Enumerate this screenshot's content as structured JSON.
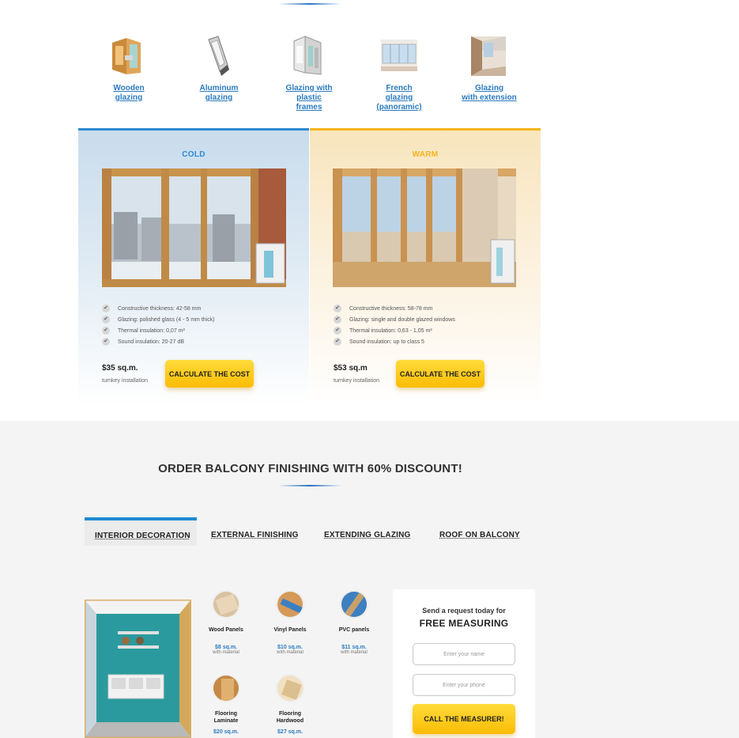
{
  "glazing_types": [
    {
      "line1": "Wooden",
      "line2": "glazing",
      "line3": "",
      "icon": "wooden-window-profile-icon"
    },
    {
      "line1": "Aluminum",
      "line2": "glazing",
      "line3": "",
      "icon": "aluminum-window-profile-icon"
    },
    {
      "line1": "Glazing with",
      "line2": "plastic",
      "line3": "frames",
      "icon": "plastic-window-profile-icon"
    },
    {
      "line1": "French",
      "line2": "glazing",
      "line3": "(panoramic)",
      "icon": "french-glazing-icon"
    },
    {
      "line1": "Glazing",
      "line2": "with extension",
      "line3": "",
      "icon": "glazing-extension-icon"
    }
  ],
  "cards": {
    "cold": {
      "title": "COLD",
      "specs": [
        "Constructive thickness: 42-58 mm",
        "Glazing: polished glass (4 - 5 mm thick)",
        "Thermal insulation: 0,07 m²",
        "Sound insulation: 20-27 dB"
      ],
      "price": "$35 sq.m.",
      "price_note": "turnkey installation",
      "button": "CALCULATE THE COST",
      "accent": "#2b8bd1"
    },
    "warm": {
      "title": "WARM",
      "specs": [
        "Constructive thickness: 58-78 mm",
        "Glazing: single and double glazed windows",
        " Thermal insulation: 0,63 - 1,05 m²",
        "Sound insulation: up to class 5"
      ],
      "price": "$53 sq.m",
      "price_note": "turnkey installation",
      "button": "CALCULATE THE COST",
      "accent": "#f4b51c"
    }
  },
  "finishing": {
    "title": "ORDER BALCONY FINISHING WITH 60% DISCOUNT!",
    "tabs": [
      "INTERIOR DECORATION",
      "EXTERNAL FINISHING",
      "EXTENDING GLAZING",
      "ROOF ON BALCONY"
    ],
    "active_tab": "INTERIOR DECORATION",
    "materials": [
      {
        "name1": "Wood Panels",
        "name2": "",
        "price": "$8 sq.m.",
        "note": "with material"
      },
      {
        "name1": "Vinyl Panels",
        "name2": "",
        "price": "$10 sq.m.",
        "note": "with material"
      },
      {
        "name1": "PVC panels",
        "name2": "",
        "price": "$11 sq.m.",
        "note": "with material"
      },
      {
        "name1": "Flooring",
        "name2": "Laminate",
        "price": "$20 sq.m.",
        "note": ""
      },
      {
        "name1": "Flooring",
        "name2": "Hardwood",
        "price": "$27 sq.m.",
        "note": ""
      }
    ]
  },
  "request_form": {
    "line1": "Send a request today for",
    "line2": "FREE MEASURING",
    "name_placeholder": "Enter your name",
    "phone_placeholder": "Enter your phone",
    "button": "CALL THE MEASURER!"
  },
  "colors": {
    "link": "#2b7bbf",
    "button": "#fbbc05",
    "active_tab": "#1e8ad0"
  }
}
